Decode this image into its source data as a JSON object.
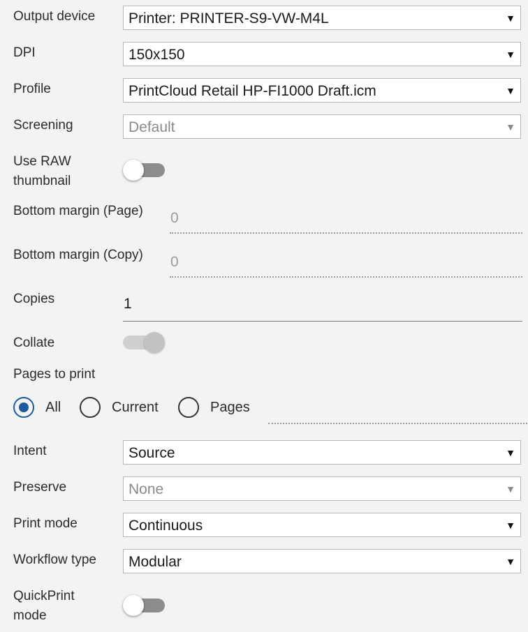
{
  "output_device": {
    "label": "Output device",
    "value": "Printer: PRINTER-S9-VW-M4L"
  },
  "dpi": {
    "label": "DPI",
    "value": "150x150"
  },
  "profile": {
    "label": "Profile",
    "value": "PrintCloud Retail HP-FI1000 Draft.icm"
  },
  "screening": {
    "label": "Screening",
    "value": "Default"
  },
  "raw_thumbnail": {
    "label_line1": "Use RAW",
    "label_line2": "thumbnail",
    "on": false
  },
  "bottom_margin_page": {
    "label": "Bottom margin (Page)",
    "value": "0"
  },
  "bottom_margin_copy": {
    "label": "Bottom margin (Copy)",
    "value": "0"
  },
  "copies": {
    "label": "Copies",
    "value": "1"
  },
  "collate": {
    "label": "Collate",
    "on": true,
    "enabled": false
  },
  "pages_to_print": {
    "label": "Pages to print",
    "options": [
      "All",
      "Current",
      "Pages"
    ],
    "selected": "All",
    "pages_value": ""
  },
  "intent": {
    "label": "Intent",
    "value": "Source"
  },
  "preserve": {
    "label": "Preserve",
    "value": "None"
  },
  "print_mode": {
    "label": "Print mode",
    "value": "Continuous"
  },
  "workflow_type": {
    "label": "Workflow type",
    "value": "Modular"
  },
  "quickprint_mode": {
    "label_line1": "QuickPrint",
    "label_line2": "mode",
    "on": false
  },
  "icons": {
    "dropdown": "dropdown-arrow-icon"
  },
  "colors": {
    "accent": "#1f5a9e",
    "background": "#f3f3f3"
  }
}
